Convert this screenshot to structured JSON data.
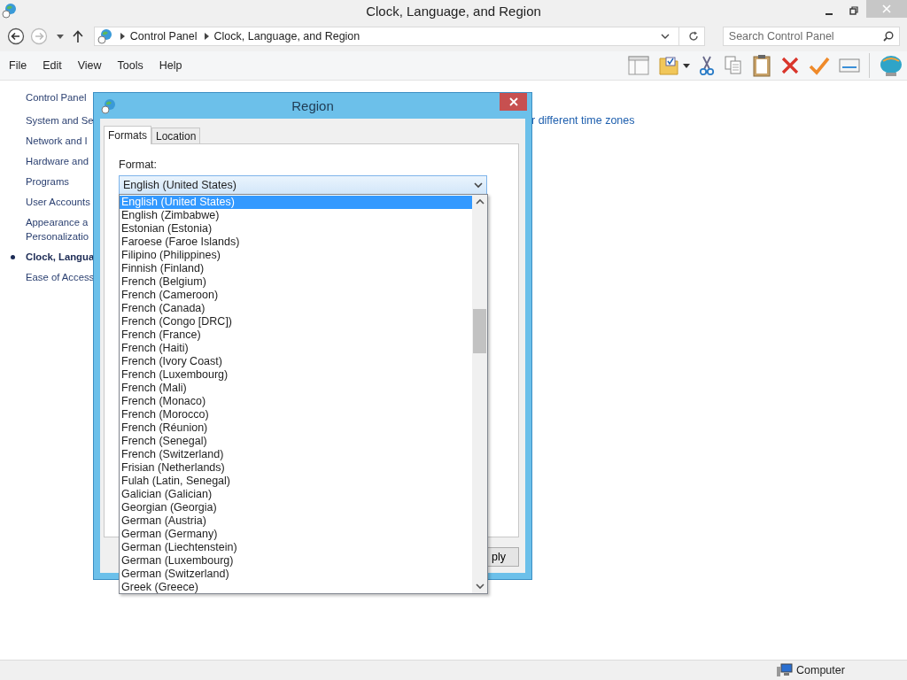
{
  "window": {
    "title": "Clock, Language, and Region"
  },
  "address_bar": {
    "breadcrumbs": [
      "Control Panel",
      "Clock, Language, and Region"
    ]
  },
  "search": {
    "placeholder": "Search Control Panel"
  },
  "menu": [
    "File",
    "Edit",
    "View",
    "Tools",
    "Help"
  ],
  "sidebar": {
    "items": [
      {
        "lines": [
          "Control Panel"
        ],
        "selected": false
      },
      {
        "lines": [
          "System and Se"
        ],
        "selected": false
      },
      {
        "lines": [
          "Network and I"
        ],
        "selected": false
      },
      {
        "lines": [
          "Hardware and"
        ],
        "selected": false
      },
      {
        "lines": [
          "Programs"
        ],
        "selected": false
      },
      {
        "lines": [
          "User Accounts"
        ],
        "selected": false
      },
      {
        "lines": [
          "Appearance a",
          "Personalizatio"
        ],
        "selected": false
      },
      {
        "lines": [
          "Clock, Langua"
        ],
        "selected": true
      },
      {
        "lines": [
          "Ease of Access"
        ],
        "selected": false
      }
    ]
  },
  "content": {
    "link_fragment": "r different time zones"
  },
  "dialog": {
    "title": "Region",
    "tabs": [
      {
        "label": "Formats",
        "selected": true
      },
      {
        "label": "Location",
        "selected": false
      }
    ],
    "format_label": "Format:",
    "format_value": "English (United States)",
    "options": [
      {
        "label": "English (United States)",
        "selected": true
      },
      {
        "label": "English (Zimbabwe)",
        "selected": false
      },
      {
        "label": "Estonian (Estonia)",
        "selected": false
      },
      {
        "label": "Faroese (Faroe Islands)",
        "selected": false
      },
      {
        "label": "Filipino (Philippines)",
        "selected": false
      },
      {
        "label": "Finnish (Finland)",
        "selected": false
      },
      {
        "label": "French (Belgium)",
        "selected": false
      },
      {
        "label": "French (Cameroon)",
        "selected": false
      },
      {
        "label": "French (Canada)",
        "selected": false
      },
      {
        "label": "French (Congo [DRC])",
        "selected": false
      },
      {
        "label": "French (France)",
        "selected": false
      },
      {
        "label": "French (Haiti)",
        "selected": false
      },
      {
        "label": "French (Ivory Coast)",
        "selected": false
      },
      {
        "label": "French (Luxembourg)",
        "selected": false
      },
      {
        "label": "French (Mali)",
        "selected": false
      },
      {
        "label": "French (Monaco)",
        "selected": false
      },
      {
        "label": "French (Morocco)",
        "selected": false
      },
      {
        "label": "French (Réunion)",
        "selected": false
      },
      {
        "label": "French (Senegal)",
        "selected": false
      },
      {
        "label": "French (Switzerland)",
        "selected": false
      },
      {
        "label": "Frisian (Netherlands)",
        "selected": false
      },
      {
        "label": "Fulah (Latin, Senegal)",
        "selected": false
      },
      {
        "label": "Galician (Galician)",
        "selected": false
      },
      {
        "label": "Georgian (Georgia)",
        "selected": false
      },
      {
        "label": "German (Austria)",
        "selected": false
      },
      {
        "label": "German (Germany)",
        "selected": false
      },
      {
        "label": "German (Liechtenstein)",
        "selected": false
      },
      {
        "label": "German (Luxembourg)",
        "selected": false
      },
      {
        "label": "German (Switzerland)",
        "selected": false
      },
      {
        "label": "Greek (Greece)",
        "selected": false
      }
    ],
    "apply_button": "ply"
  },
  "status_bar": {
    "computer": "Computer"
  }
}
